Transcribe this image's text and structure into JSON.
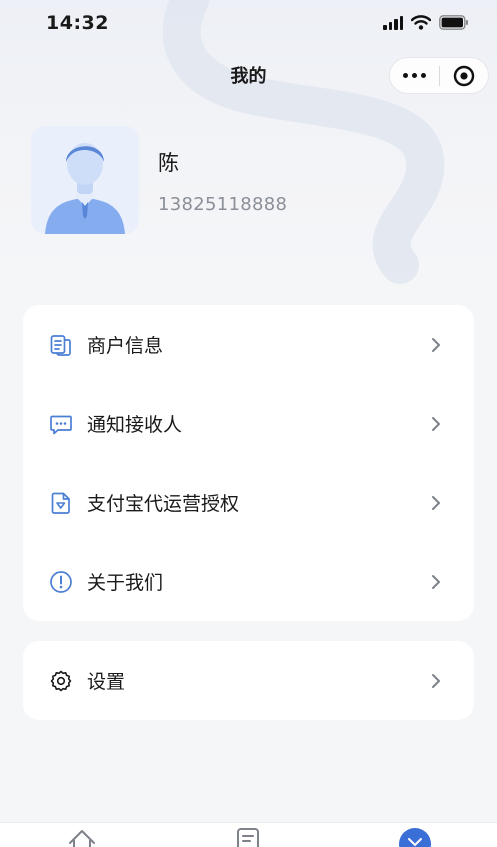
{
  "status_bar": {
    "time": "14:32"
  },
  "nav": {
    "title": "我的",
    "more_icon": "more-dots-icon",
    "close_icon": "target-close-icon"
  },
  "profile": {
    "name": "陈",
    "phone": "13825118888",
    "avatar_icon": "default-person-avatar"
  },
  "menu": [
    {
      "label": "商户信息",
      "icon": "merchant-doc-icon"
    },
    {
      "label": "通知接收人",
      "icon": "message-icon"
    },
    {
      "label": "支付宝代运营授权",
      "icon": "auth-file-icon"
    },
    {
      "label": "关于我们",
      "icon": "info-icon"
    }
  ],
  "settings": {
    "label": "设置",
    "icon": "gear-icon"
  },
  "tab_bar": {
    "tabs": [
      {
        "icon": "home-icon"
      },
      {
        "icon": "orders-icon"
      },
      {
        "icon": "profile-icon",
        "active": true
      }
    ]
  },
  "colors": {
    "accent": "#3b6fd8",
    "icon_blue": "#4a7fd4",
    "background": "#f5f6f8",
    "card": "#ffffff",
    "secondary_text": "#8a8f98"
  }
}
